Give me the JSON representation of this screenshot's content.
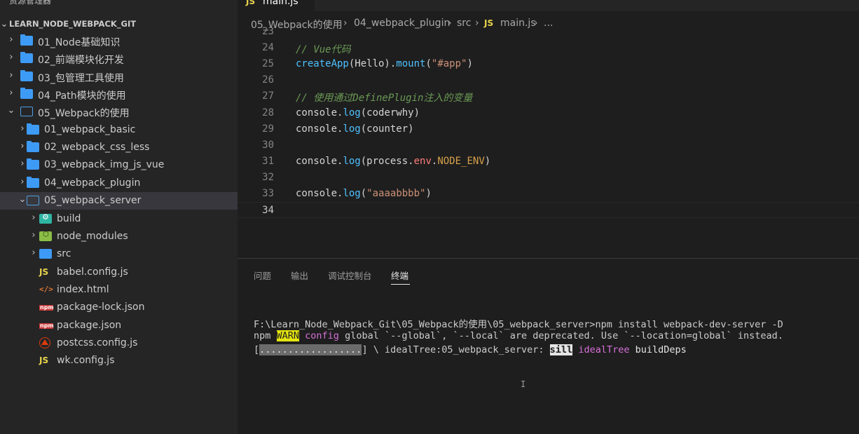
{
  "sidebar": {
    "title": "资源管理器",
    "more_icon": "···",
    "section": {
      "chevron": "⌄",
      "label": "LEARN_NODE_WEBPACK_GIT"
    },
    "items": [
      {
        "label": "01_Node基础知识",
        "twisty": "›",
        "icon": "folder-icon"
      },
      {
        "label": "02_前端模块化开发",
        "twisty": "›",
        "icon": "folder-icon"
      },
      {
        "label": "03_包管理工具使用",
        "twisty": "›",
        "icon": "folder-icon"
      },
      {
        "label": "04_Path模块的使用",
        "twisty": "›",
        "icon": "folder-icon"
      },
      {
        "label": "05_Webpack的使用",
        "twisty": "⌄",
        "icon": "folder-open-icon"
      },
      {
        "label": "01_webpack_basic",
        "twisty": "›",
        "icon": "folder-icon"
      },
      {
        "label": "02_webpack_css_less",
        "twisty": "›",
        "icon": "folder-icon"
      },
      {
        "label": "03_webpack_img_js_vue",
        "twisty": "›",
        "icon": "folder-icon"
      },
      {
        "label": "04_webpack_plugin",
        "twisty": "›",
        "icon": "folder-icon"
      },
      {
        "label": "05_webpack_server",
        "twisty": "⌄",
        "icon": "folder-open-icon"
      },
      {
        "label": "build",
        "twisty": "›",
        "icon": "build-folder-icon"
      },
      {
        "label": "node_modules",
        "twisty": "›",
        "icon": "node-modules-folder-icon"
      },
      {
        "label": "src",
        "twisty": "›",
        "icon": "src-folder-icon"
      },
      {
        "label": "babel.config.js",
        "twisty": "",
        "icon": "js-file-icon",
        "icon_text": "JS"
      },
      {
        "label": "index.html",
        "twisty": "",
        "icon": "html-file-icon",
        "icon_text": "</>"
      },
      {
        "label": "package-lock.json",
        "twisty": "",
        "icon": "npm-file-icon",
        "icon_text": "npm"
      },
      {
        "label": "package.json",
        "twisty": "",
        "icon": "npm-file-icon",
        "icon_text": "npm"
      },
      {
        "label": "postcss.config.js",
        "twisty": "",
        "icon": "postcss-file-icon"
      },
      {
        "label": "wk.config.js",
        "twisty": "",
        "icon": "js-file-icon",
        "icon_text": "JS"
      }
    ]
  },
  "tab": {
    "icon_text": "JS",
    "name": "main.js"
  },
  "breadcrumb": {
    "sep": "›",
    "items": [
      "05_Webpack的使用",
      "04_webpack_plugin",
      "src"
    ],
    "js_icon": "JS",
    "file": "main.js",
    "ellipsis": "..."
  },
  "editor": {
    "lines": [
      {
        "num": "23",
        "tokens": []
      },
      {
        "num": "24",
        "tokens": [
          {
            "t": "// Vue代码",
            "c": "c-comment"
          }
        ]
      },
      {
        "num": "25",
        "tokens": [
          {
            "t": "createApp",
            "c": "c-fn"
          },
          {
            "t": "(Hello).",
            "c": "c-plain"
          },
          {
            "t": "mount",
            "c": "c-method"
          },
          {
            "t": "(",
            "c": "c-plain"
          },
          {
            "t": "\"#app\"",
            "c": "c-str"
          },
          {
            "t": ")",
            "c": "c-plain"
          }
        ]
      },
      {
        "num": "26",
        "tokens": []
      },
      {
        "num": "27",
        "tokens": [
          {
            "t": "// 使用通过DefinePlugin注入的变量",
            "c": "c-comment"
          }
        ]
      },
      {
        "num": "28",
        "tokens": [
          {
            "t": "console.",
            "c": "c-plain"
          },
          {
            "t": "log",
            "c": "c-method"
          },
          {
            "t": "(coderwhy)",
            "c": "c-plain"
          }
        ]
      },
      {
        "num": "29",
        "tokens": [
          {
            "t": "console.",
            "c": "c-plain"
          },
          {
            "t": "log",
            "c": "c-method"
          },
          {
            "t": "(counter)",
            "c": "c-plain"
          }
        ]
      },
      {
        "num": "30",
        "tokens": []
      },
      {
        "num": "31",
        "tokens": [
          {
            "t": "console.",
            "c": "c-plain"
          },
          {
            "t": "log",
            "c": "c-method"
          },
          {
            "t": "(process.",
            "c": "c-plain"
          },
          {
            "t": "env",
            "c": "c-prop"
          },
          {
            "t": ".",
            "c": "c-plain"
          },
          {
            "t": "NODE_ENV",
            "c": "c-const"
          },
          {
            "t": ")",
            "c": "c-plain"
          }
        ]
      },
      {
        "num": "32",
        "tokens": []
      },
      {
        "num": "33",
        "tokens": [
          {
            "t": "console.",
            "c": "c-plain"
          },
          {
            "t": "log",
            "c": "c-method"
          },
          {
            "t": "(",
            "c": "c-plain"
          },
          {
            "t": "\"aaaabbbb\"",
            "c": "c-str"
          },
          {
            "t": ")",
            "c": "c-plain"
          }
        ]
      },
      {
        "num": "34",
        "tokens": [],
        "current": true
      }
    ]
  },
  "panel": {
    "tabs": [
      {
        "label": "问题",
        "active": false
      },
      {
        "label": "输出",
        "active": false
      },
      {
        "label": "调试控制台",
        "active": false
      },
      {
        "label": "终端",
        "active": true
      }
    ],
    "terminal": [
      [
        {
          "t": "F:\\Learn_Node_Webpack_Git\\05_Webpack的使用\\05_webpack_server>npm install webpack-dev-server -D",
          "c": ""
        }
      ],
      [
        {
          "t": "npm ",
          "c": ""
        },
        {
          "t": "WARN",
          "c": "t-warn"
        },
        {
          "t": " ",
          "c": ""
        },
        {
          "t": "config",
          "c": "t-magenta"
        },
        {
          "t": " global `--global`, `--local` are deprecated. Use `--location=global` instead.",
          "c": ""
        }
      ],
      [
        {
          "t": "[",
          "c": ""
        },
        {
          "t": "..................",
          "c": "t-progress"
        },
        {
          "t": "] \\ idealTree:05_webpack_server: ",
          "c": ""
        },
        {
          "t": "sill",
          "c": "t-sill"
        },
        {
          "t": " ",
          "c": ""
        },
        {
          "t": "idealTree",
          "c": "t-magenta"
        },
        {
          "t": " buildDeps",
          "c": "t-bold"
        }
      ]
    ],
    "cursor": "I"
  }
}
